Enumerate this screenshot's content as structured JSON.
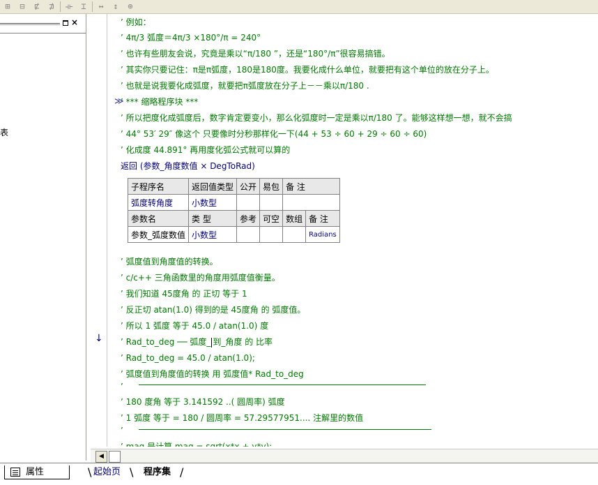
{
  "toolbar": {
    "icons": [
      "align-left-icon",
      "align-center-icon",
      "align-right-icon",
      "align-justify-icon",
      "space-horizontal-icon",
      "space-vertical-icon",
      "same-width-icon",
      "same-height-icon",
      "same-size-icon"
    ],
    "glyphs": [
      "⊞",
      "⊟",
      "⋢",
      "⋣",
      "⟛",
      "⌶",
      "↔",
      "↕",
      "⊕"
    ]
  },
  "left_panel": {
    "close_glyph": "×",
    "clipped_text": "表"
  },
  "editor": {
    "lines": [
      "’ 例如：",
      "’ 4π/3 弧度＝4π/3 ×180°/π  = 240°",
      "’ 也许有些朋友会说，究竟是乘以“π/180 ”，还是“180°/π”很容易搞错。",
      "’ 其实你只要记住：π是π弧度，180是180度。我要化成什么单位，就要把有这个单位的放在分子上。",
      "’ 也就是说我要化成弧度，就要把π弧度放在分子上－－乘以π/180 .",
      "’ *** 缩略程序块 ***",
      "’ 所以把度化成弧度后，数字肯定要变小，那么化弧度时一定是乘以π/180 了。能够这样想一想，就不会搞",
      "’ 44° 53′ 29″  像这个 只要像时分秒那样化一下(44 + 53 ÷ 60 + 29 ÷ 60 ÷ 60)",
      "’ 化成度 44.891° 再用度化弧公式就可以算的"
    ],
    "return_keyword": "返回",
    "return_args": " (参数_角度数值 × DegToRad)",
    "lines_after": [
      "’ 弧度值到角度值的转换。",
      "’ c/c++ 三角函数里的角度用弧度值衡量。",
      "’ 我们知道 45度角 的  正切 等于 1",
      "’ 反正切 atan(1.0) 得到的是 45度角 的 弧度值。",
      "’ 所以 1 弧度 等于    45.0 / atan(1.0)  度"
    ],
    "rad_line_before_caret": "’ Rad_to_deg  ── 弧度_",
    "rad_line_after_caret": "到_角度 的 比率",
    "lines_after_caret": [
      "’ Rad_to_deg  = 45.0 / atan(1.0);",
      "’ 弧度值到角度值的转换  用  弧度值* Rad_to_deg"
    ],
    "pi_lines": [
      "’ 180 度角 等于 3.141592 ..( 圆周率) 弧度",
      "’ 1 弧度 等于 = 180 / 圆周率 = 57.29577951.... 注解里的数值"
    ],
    "last_line": "’ mag 是计算 mag = sqrt(x*x + y*y);",
    "apostrophe": "’",
    "collapse_marker": "≫",
    "exec_marker": "↓"
  },
  "sub_table": {
    "header1": [
      "子程序名",
      "返回值类型",
      "公开",
      "易包",
      "备 注"
    ],
    "row1": [
      "弧度转角度",
      "小数型",
      "",
      "",
      ""
    ],
    "header2": [
      "参数名",
      "类 型",
      "参考",
      "可空",
      "数组",
      "备 注"
    ],
    "row2": [
      "参数_弧度数值",
      "小数型",
      "",
      "",
      "",
      "Radians"
    ]
  },
  "bottom": {
    "properties_tab": "属性",
    "tab_start": "起始页",
    "tab_program": "程序集",
    "scroll_left": "◀"
  }
}
